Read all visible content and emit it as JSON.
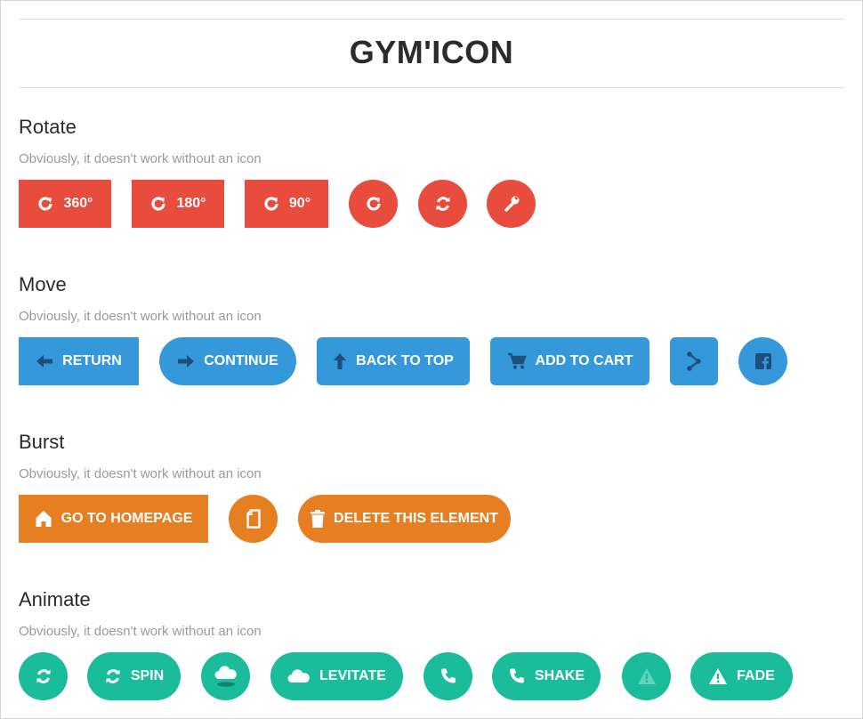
{
  "header": {
    "title": "GYM'ICON"
  },
  "sections": {
    "rotate": {
      "title": "Rotate",
      "subtitle": "Obviously, it doesn't work without an icon",
      "buttons": {
        "b360": "360°",
        "b180": "180°",
        "b90": "90°"
      },
      "color": "#e84c3d"
    },
    "move": {
      "title": "Move",
      "subtitle": "Obviously, it doesn't work without an icon",
      "buttons": {
        "return": "RETURN",
        "continue": "CONTINUE",
        "back_to_top": "BACK TO TOP",
        "add_to_cart": "ADD TO CART"
      },
      "color": "#3498db"
    },
    "burst": {
      "title": "Burst",
      "subtitle": "Obviously, it doesn't work without an icon",
      "buttons": {
        "go_home": "GO TO HOMEPAGE",
        "delete": "DELETE THIS ELEMENT"
      },
      "color": "#e67e22"
    },
    "animate": {
      "title": "Animate",
      "subtitle": "Obviously, it doesn't work without an icon",
      "buttons": {
        "spin": "SPIN",
        "levitate": "LEVITATE",
        "shake": "SHAKE",
        "fade": "FADE"
      },
      "color": "#1abc9c"
    }
  },
  "icons": [
    "rotate-icon",
    "refresh-icon",
    "wrench-icon",
    "arrow-left-icon",
    "arrow-right-icon",
    "arrow-up-icon",
    "cart-icon",
    "share-icon",
    "facebook-icon",
    "home-icon",
    "file-icon",
    "trash-icon",
    "cloud-icon",
    "phone-icon",
    "warning-icon"
  ]
}
